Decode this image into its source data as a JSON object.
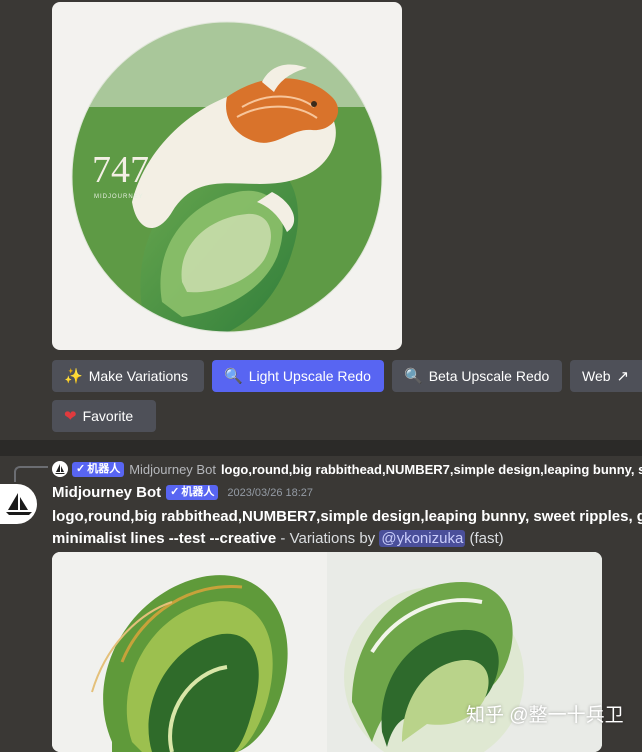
{
  "top_image": {
    "logo_text": "747",
    "logo_subtext": "MIDJOURNEY"
  },
  "buttons": {
    "make_variations": "Make Variations",
    "light_upscale_redo": "Light Upscale Redo",
    "beta_upscale_redo": "Beta Upscale Redo",
    "web": "Web",
    "favorite": "Favorite"
  },
  "icons": {
    "make_variations": "magic-wand-icon",
    "light_upscale": "magnifier-icon",
    "beta_upscale": "magnifier-icon",
    "web": "external-link-icon",
    "favorite": "heart-icon"
  },
  "reply": {
    "badge": "机器人",
    "name": "Midjourney Bot",
    "text": "logo,round,big rabbithead,NUMBER7,simple design,leaping bunny, s"
  },
  "message": {
    "author": "Midjourney Bot",
    "badge": "机器人",
    "timestamp": "2023/03/26 18:27",
    "prompt_line1": "logo,round,big rabbithead,NUMBER7,simple design,leaping bunny, sweet ripples, gre",
    "prompt_line2": "minimalist lines --test --creative",
    "suffix": " - Variations by ",
    "mention": "@ykonizuka",
    "speed": " (fast)"
  },
  "watermark": "知乎 @整一十兵卫",
  "colors": {
    "accent": "#5865f2",
    "button": "#4e5058",
    "background": "#3a3835"
  }
}
